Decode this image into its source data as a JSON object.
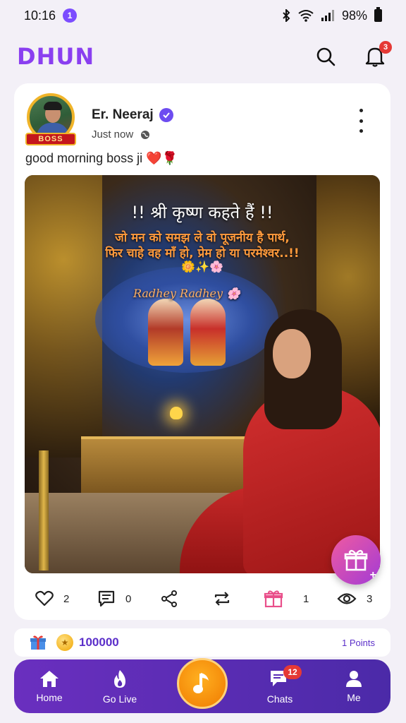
{
  "status_bar": {
    "time": "10:16",
    "notification_count": "1",
    "battery": "98%"
  },
  "header": {
    "logo": "DHUN",
    "notification_badge": "3"
  },
  "post": {
    "author": "Er. Neeraj",
    "avatar_badge": "BOSS",
    "time": "Just now",
    "caption": "good morning boss ji ❤️🌹",
    "image_text": {
      "title": "!! श्री कृष्ण कहते हैं !!",
      "line1": "जो मन को समझ ले वो पूजनीय है पार्थ,",
      "line2": "फिर चाहे वह माँ हो, प्रेम हो या परमेश्वर..!!",
      "emoji_line": "🌼✨🌸",
      "signature": "Radhey Radhey 🌸"
    },
    "stats": {
      "likes": "2",
      "comments": "0",
      "gifts": "1",
      "views": "3"
    }
  },
  "points_bar": {
    "coins": "100000",
    "points_label": "1 Points"
  },
  "bottom_nav": {
    "home": "Home",
    "go_live": "Go Live",
    "chats": "Chats",
    "chats_badge": "12",
    "me": "Me"
  },
  "colors": {
    "brand": "#8a3ff0",
    "nav_gradient_start": "#6a2fbf",
    "nav_gradient_end": "#4b2aa8",
    "gift_pink": "#e94f8a",
    "badge_red": "#e53935"
  },
  "icons": [
    "search-icon",
    "bell-icon",
    "verified-icon",
    "globe-icon",
    "more-icon",
    "heart-icon",
    "comment-icon",
    "share-icon",
    "repost-icon",
    "gift-icon",
    "eye-icon",
    "home-icon",
    "fire-icon",
    "music-icon",
    "chat-icon",
    "user-icon"
  ]
}
